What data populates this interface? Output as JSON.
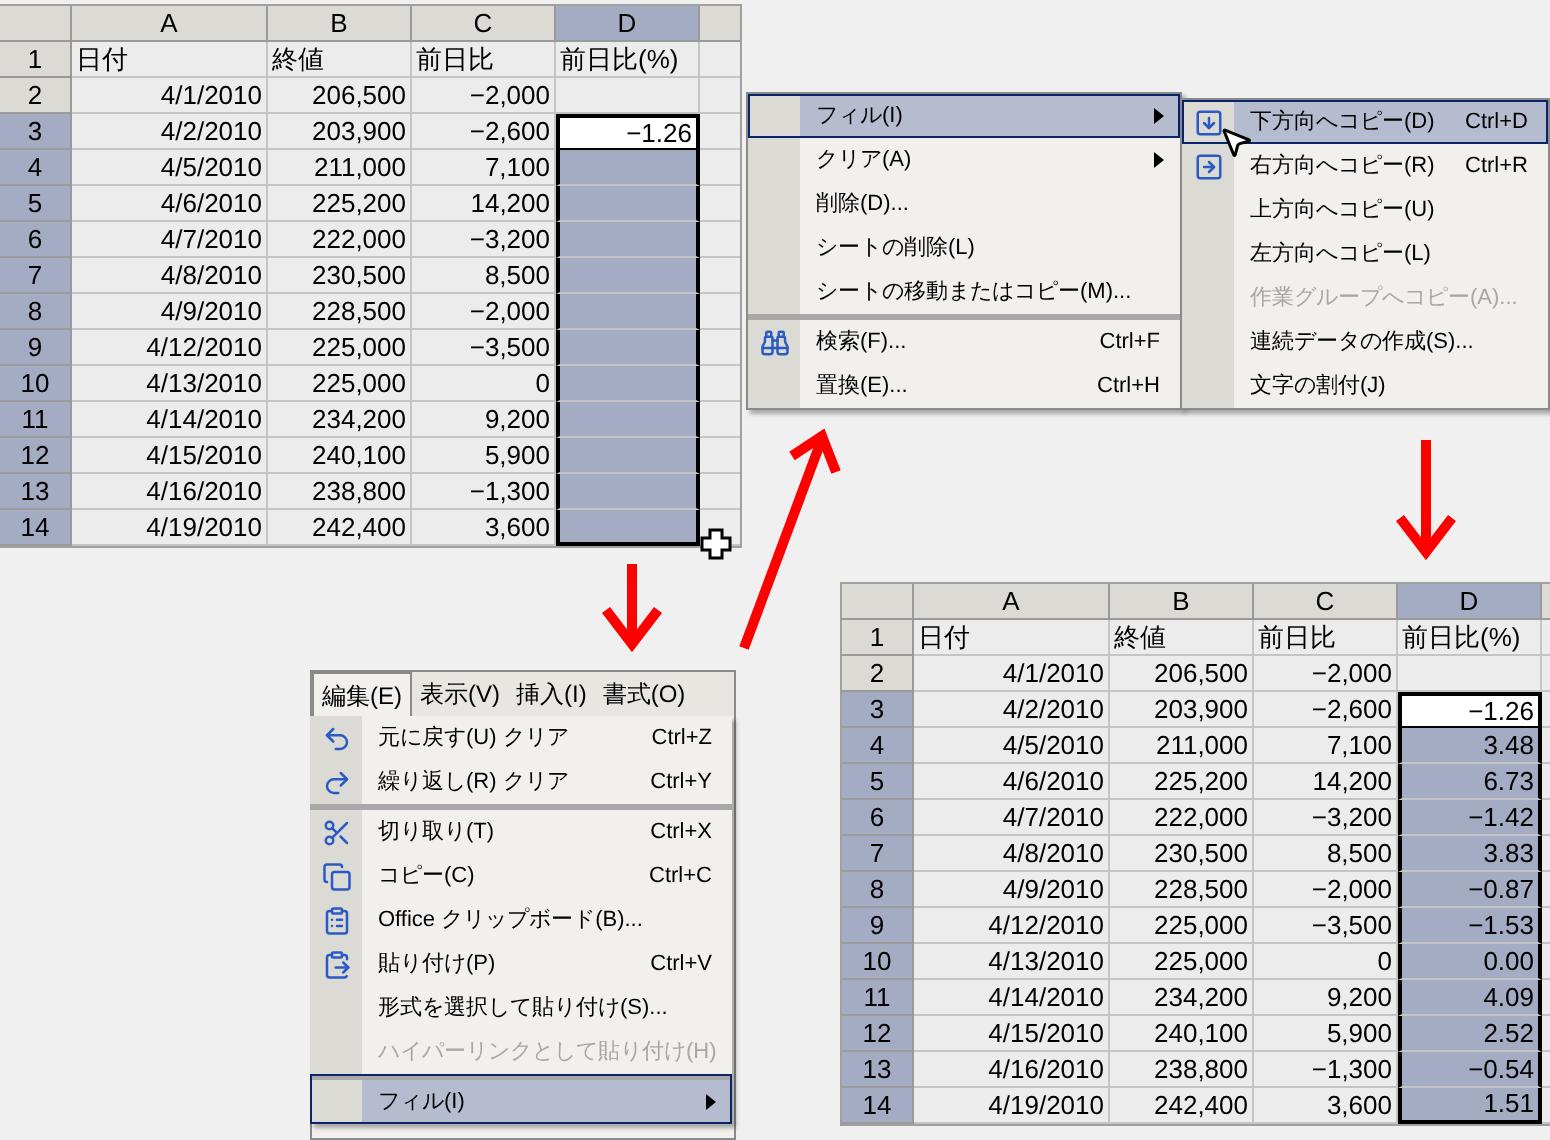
{
  "sheets": [
    {
      "columns": [
        {
          "label": "A",
          "selected": false
        },
        {
          "label": "B",
          "selected": false
        },
        {
          "label": "C",
          "selected": false
        },
        {
          "label": "D",
          "selected": true
        }
      ],
      "rows": [
        {
          "num": "1",
          "selected": false,
          "active": false,
          "cells": [
            "日付",
            "終値",
            "前日比",
            "前日比(%)"
          ]
        },
        {
          "num": "2",
          "selected": false,
          "active": false,
          "cells": [
            "4/1/2010",
            "206,500",
            "−2,000"
          ]
        },
        {
          "num": "3",
          "selected": true,
          "active": true,
          "cells": [
            "4/2/2010",
            "203,900",
            "−2,600",
            "−1.26"
          ]
        },
        {
          "num": "4",
          "selected": true,
          "active": false,
          "cells": [
            "4/5/2010",
            "211,000",
            "7,100"
          ]
        },
        {
          "num": "5",
          "selected": true,
          "active": false,
          "cells": [
            "4/6/2010",
            "225,200",
            "14,200"
          ]
        },
        {
          "num": "6",
          "selected": true,
          "active": false,
          "cells": [
            "4/7/2010",
            "222,000",
            "−3,200"
          ]
        },
        {
          "num": "7",
          "selected": true,
          "active": false,
          "cells": [
            "4/8/2010",
            "230,500",
            "8,500"
          ]
        },
        {
          "num": "8",
          "selected": true,
          "active": false,
          "cells": [
            "4/9/2010",
            "228,500",
            "−2,000"
          ]
        },
        {
          "num": "9",
          "selected": true,
          "active": false,
          "cells": [
            "4/12/2010",
            "225,000",
            "−3,500"
          ]
        },
        {
          "num": "10",
          "selected": true,
          "active": false,
          "cells": [
            "4/13/2010",
            "225,000",
            "0"
          ]
        },
        {
          "num": "11",
          "selected": true,
          "active": false,
          "cells": [
            "4/14/2010",
            "234,200",
            "9,200"
          ]
        },
        {
          "num": "12",
          "selected": true,
          "active": false,
          "cells": [
            "4/15/2010",
            "240,100",
            "5,900"
          ]
        },
        {
          "num": "13",
          "selected": true,
          "active": false,
          "cells": [
            "4/16/2010",
            "238,800",
            "−1,300"
          ]
        },
        {
          "num": "14",
          "selected": true,
          "active": false,
          "cells": [
            "4/19/2010",
            "242,400",
            "3,600"
          ]
        }
      ]
    },
    {
      "columns": [
        {
          "label": "A",
          "selected": false
        },
        {
          "label": "B",
          "selected": false
        },
        {
          "label": "C",
          "selected": false
        },
        {
          "label": "D",
          "selected": true
        }
      ],
      "rows": [
        {
          "num": "1",
          "selected": false,
          "active": false,
          "cells": [
            "日付",
            "終値",
            "前日比",
            "前日比(%)"
          ]
        },
        {
          "num": "2",
          "selected": false,
          "active": false,
          "cells": [
            "4/1/2010",
            "206,500",
            "−2,000"
          ]
        },
        {
          "num": "3",
          "selected": true,
          "active": true,
          "cells": [
            "4/2/2010",
            "203,900",
            "−2,600",
            "−1.26"
          ]
        },
        {
          "num": "4",
          "selected": true,
          "active": false,
          "cells": [
            "4/5/2010",
            "211,000",
            "7,100",
            "3.48"
          ]
        },
        {
          "num": "5",
          "selected": true,
          "active": false,
          "cells": [
            "4/6/2010",
            "225,200",
            "14,200",
            "6.73"
          ]
        },
        {
          "num": "6",
          "selected": true,
          "active": false,
          "cells": [
            "4/7/2010",
            "222,000",
            "−3,200",
            "−1.42"
          ]
        },
        {
          "num": "7",
          "selected": true,
          "active": false,
          "cells": [
            "4/8/2010",
            "230,500",
            "8,500",
            "3.83"
          ]
        },
        {
          "num": "8",
          "selected": true,
          "active": false,
          "cells": [
            "4/9/2010",
            "228,500",
            "−2,000",
            "−0.87"
          ]
        },
        {
          "num": "9",
          "selected": true,
          "active": false,
          "cells": [
            "4/12/2010",
            "225,000",
            "−3,500",
            "−1.53"
          ]
        },
        {
          "num": "10",
          "selected": true,
          "active": false,
          "cells": [
            "4/13/2010",
            "225,000",
            "0",
            "0.00"
          ]
        },
        {
          "num": "11",
          "selected": true,
          "active": false,
          "cells": [
            "4/14/2010",
            "234,200",
            "9,200",
            "4.09"
          ]
        },
        {
          "num": "12",
          "selected": true,
          "active": false,
          "cells": [
            "4/15/2010",
            "240,100",
            "5,900",
            "2.52"
          ]
        },
        {
          "num": "13",
          "selected": true,
          "active": false,
          "cells": [
            "4/16/2010",
            "238,800",
            "−1,300",
            "−0.54"
          ]
        },
        {
          "num": "14",
          "selected": true,
          "active": false,
          "cells": [
            "4/19/2010",
            "242,400",
            "3,600",
            "1.51"
          ]
        }
      ]
    }
  ],
  "edit_menu": {
    "menubar": [
      {
        "label": "編集(E)",
        "selected": true
      },
      {
        "label": "表示(V)",
        "selected": false
      },
      {
        "label": "挿入(I)",
        "selected": false
      },
      {
        "label": "書式(O)",
        "selected": false
      }
    ],
    "items": [
      {
        "label": "元に戻す(U) クリア",
        "shortcut": "Ctrl+Z",
        "selected": false,
        "disabled": false,
        "submenu": false,
        "separator_before": false
      },
      {
        "label": "繰り返し(R) クリア",
        "shortcut": "Ctrl+Y",
        "selected": false,
        "disabled": false,
        "submenu": false,
        "separator_before": false
      },
      {
        "label": "切り取り(T)",
        "shortcut": "Ctrl+X",
        "selected": false,
        "disabled": false,
        "submenu": false,
        "separator_before": true
      },
      {
        "label": "コピー(C)",
        "shortcut": "Ctrl+C",
        "selected": false,
        "disabled": false,
        "submenu": false,
        "separator_before": false
      },
      {
        "label": "Office クリップボード(B)...",
        "selected": false,
        "disabled": false,
        "submenu": false,
        "separator_before": false
      },
      {
        "label": "貼り付け(P)",
        "shortcut": "Ctrl+V",
        "selected": false,
        "disabled": false,
        "submenu": false,
        "separator_before": false
      },
      {
        "label": "形式を選択して貼り付け(S)...",
        "selected": false,
        "disabled": false,
        "submenu": false,
        "separator_before": false
      },
      {
        "label": "ハイパーリンクとして貼り付け(H)",
        "selected": false,
        "disabled": true,
        "submenu": false,
        "separator_before": false
      },
      {
        "label": "フィル(I)",
        "selected": true,
        "disabled": false,
        "submenu": true,
        "separator_before": true
      }
    ]
  },
  "fill_menu": {
    "items": [
      {
        "label": "フィル(I)",
        "selected": true,
        "disabled": false,
        "submenu": true,
        "separator_before": false
      },
      {
        "label": "クリア(A)",
        "selected": false,
        "disabled": false,
        "submenu": true,
        "separator_before": false
      },
      {
        "label": "削除(D)...",
        "selected": false,
        "disabled": false,
        "submenu": false,
        "separator_before": false
      },
      {
        "label": "シートの削除(L)",
        "selected": false,
        "disabled": false,
        "submenu": false,
        "separator_before": false
      },
      {
        "label": "シートの移動またはコピー(M)...",
        "selected": false,
        "disabled": false,
        "submenu": false,
        "separator_before": false
      },
      {
        "label": "検索(F)...",
        "shortcut": "Ctrl+F",
        "selected": false,
        "disabled": false,
        "submenu": false,
        "separator_before": true
      },
      {
        "label": "置換(E)...",
        "shortcut": "Ctrl+H",
        "selected": false,
        "disabled": false,
        "submenu": false,
        "separator_before": false
      }
    ]
  },
  "fill_submenu": {
    "items": [
      {
        "label": "下方向へコピー(D)",
        "shortcut": "Ctrl+D",
        "selected": true,
        "disabled": false,
        "submenu": false,
        "separator_before": false
      },
      {
        "label": "右方向へコピー(R)",
        "shortcut": "Ctrl+R",
        "selected": false,
        "disabled": false,
        "submenu": false,
        "separator_before": false
      },
      {
        "label": "上方向へコピー(U)",
        "selected": false,
        "disabled": false,
        "submenu": false,
        "separator_before": false
      },
      {
        "label": "左方向へコピー(L)",
        "selected": false,
        "disabled": false,
        "submenu": false,
        "separator_before": false
      },
      {
        "label": "作業グループへコピー(A)...",
        "selected": false,
        "disabled": true,
        "submenu": false,
        "separator_before": false
      },
      {
        "label": "連続データの作成(S)...",
        "selected": false,
        "disabled": false,
        "submenu": false,
        "separator_before": false
      },
      {
        "label": "文字の割付(J)",
        "selected": false,
        "disabled": false,
        "submenu": false,
        "separator_before": false
      }
    ]
  }
}
